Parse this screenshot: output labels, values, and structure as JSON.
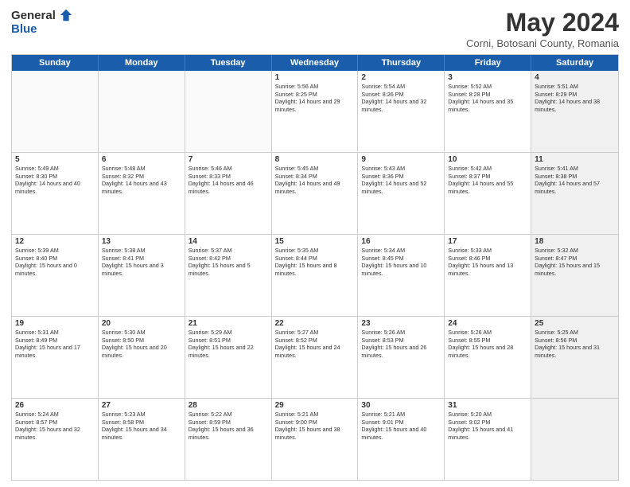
{
  "header": {
    "logo_general": "General",
    "logo_blue": "Blue",
    "title": "May 2024",
    "subtitle": "Corni, Botosani County, Romania"
  },
  "days_of_week": [
    "Sunday",
    "Monday",
    "Tuesday",
    "Wednesday",
    "Thursday",
    "Friday",
    "Saturday"
  ],
  "weeks": [
    [
      {
        "day": "",
        "empty": true
      },
      {
        "day": "",
        "empty": true
      },
      {
        "day": "",
        "empty": true
      },
      {
        "day": "1",
        "sunrise": "5:56 AM",
        "sunset": "8:25 PM",
        "daylight": "14 hours and 29 minutes."
      },
      {
        "day": "2",
        "sunrise": "5:54 AM",
        "sunset": "8:26 PM",
        "daylight": "14 hours and 32 minutes."
      },
      {
        "day": "3",
        "sunrise": "5:52 AM",
        "sunset": "8:28 PM",
        "daylight": "14 hours and 35 minutes."
      },
      {
        "day": "4",
        "sunrise": "5:51 AM",
        "sunset": "8:29 PM",
        "daylight": "14 hours and 38 minutes.",
        "shaded": true
      }
    ],
    [
      {
        "day": "5",
        "sunrise": "5:49 AM",
        "sunset": "8:30 PM",
        "daylight": "14 hours and 40 minutes."
      },
      {
        "day": "6",
        "sunrise": "5:48 AM",
        "sunset": "8:32 PM",
        "daylight": "14 hours and 43 minutes."
      },
      {
        "day": "7",
        "sunrise": "5:46 AM",
        "sunset": "8:33 PM",
        "daylight": "14 hours and 46 minutes."
      },
      {
        "day": "8",
        "sunrise": "5:45 AM",
        "sunset": "8:34 PM",
        "daylight": "14 hours and 49 minutes."
      },
      {
        "day": "9",
        "sunrise": "5:43 AM",
        "sunset": "8:36 PM",
        "daylight": "14 hours and 52 minutes."
      },
      {
        "day": "10",
        "sunrise": "5:42 AM",
        "sunset": "8:37 PM",
        "daylight": "14 hours and 55 minutes."
      },
      {
        "day": "11",
        "sunrise": "5:41 AM",
        "sunset": "8:38 PM",
        "daylight": "14 hours and 57 minutes.",
        "shaded": true
      }
    ],
    [
      {
        "day": "12",
        "sunrise": "5:39 AM",
        "sunset": "8:40 PM",
        "daylight": "15 hours and 0 minutes."
      },
      {
        "day": "13",
        "sunrise": "5:38 AM",
        "sunset": "8:41 PM",
        "daylight": "15 hours and 3 minutes."
      },
      {
        "day": "14",
        "sunrise": "5:37 AM",
        "sunset": "8:42 PM",
        "daylight": "15 hours and 5 minutes."
      },
      {
        "day": "15",
        "sunrise": "5:35 AM",
        "sunset": "8:44 PM",
        "daylight": "15 hours and 8 minutes."
      },
      {
        "day": "16",
        "sunrise": "5:34 AM",
        "sunset": "8:45 PM",
        "daylight": "15 hours and 10 minutes."
      },
      {
        "day": "17",
        "sunrise": "5:33 AM",
        "sunset": "8:46 PM",
        "daylight": "15 hours and 13 minutes."
      },
      {
        "day": "18",
        "sunrise": "5:32 AM",
        "sunset": "8:47 PM",
        "daylight": "15 hours and 15 minutes.",
        "shaded": true
      }
    ],
    [
      {
        "day": "19",
        "sunrise": "5:31 AM",
        "sunset": "8:49 PM",
        "daylight": "15 hours and 17 minutes."
      },
      {
        "day": "20",
        "sunrise": "5:30 AM",
        "sunset": "8:50 PM",
        "daylight": "15 hours and 20 minutes."
      },
      {
        "day": "21",
        "sunrise": "5:29 AM",
        "sunset": "8:51 PM",
        "daylight": "15 hours and 22 minutes."
      },
      {
        "day": "22",
        "sunrise": "5:27 AM",
        "sunset": "8:52 PM",
        "daylight": "15 hours and 24 minutes."
      },
      {
        "day": "23",
        "sunrise": "5:26 AM",
        "sunset": "8:53 PM",
        "daylight": "15 hours and 26 minutes."
      },
      {
        "day": "24",
        "sunrise": "5:26 AM",
        "sunset": "8:55 PM",
        "daylight": "15 hours and 28 minutes."
      },
      {
        "day": "25",
        "sunrise": "5:25 AM",
        "sunset": "8:56 PM",
        "daylight": "15 hours and 31 minutes.",
        "shaded": true
      }
    ],
    [
      {
        "day": "26",
        "sunrise": "5:24 AM",
        "sunset": "8:57 PM",
        "daylight": "15 hours and 32 minutes."
      },
      {
        "day": "27",
        "sunrise": "5:23 AM",
        "sunset": "8:58 PM",
        "daylight": "15 hours and 34 minutes."
      },
      {
        "day": "28",
        "sunrise": "5:22 AM",
        "sunset": "8:59 PM",
        "daylight": "15 hours and 36 minutes."
      },
      {
        "day": "29",
        "sunrise": "5:21 AM",
        "sunset": "9:00 PM",
        "daylight": "15 hours and 38 minutes."
      },
      {
        "day": "30",
        "sunrise": "5:21 AM",
        "sunset": "9:01 PM",
        "daylight": "15 hours and 40 minutes."
      },
      {
        "day": "31",
        "sunrise": "5:20 AM",
        "sunset": "9:02 PM",
        "daylight": "15 hours and 41 minutes."
      },
      {
        "day": "",
        "empty": true,
        "shaded": true
      }
    ]
  ]
}
